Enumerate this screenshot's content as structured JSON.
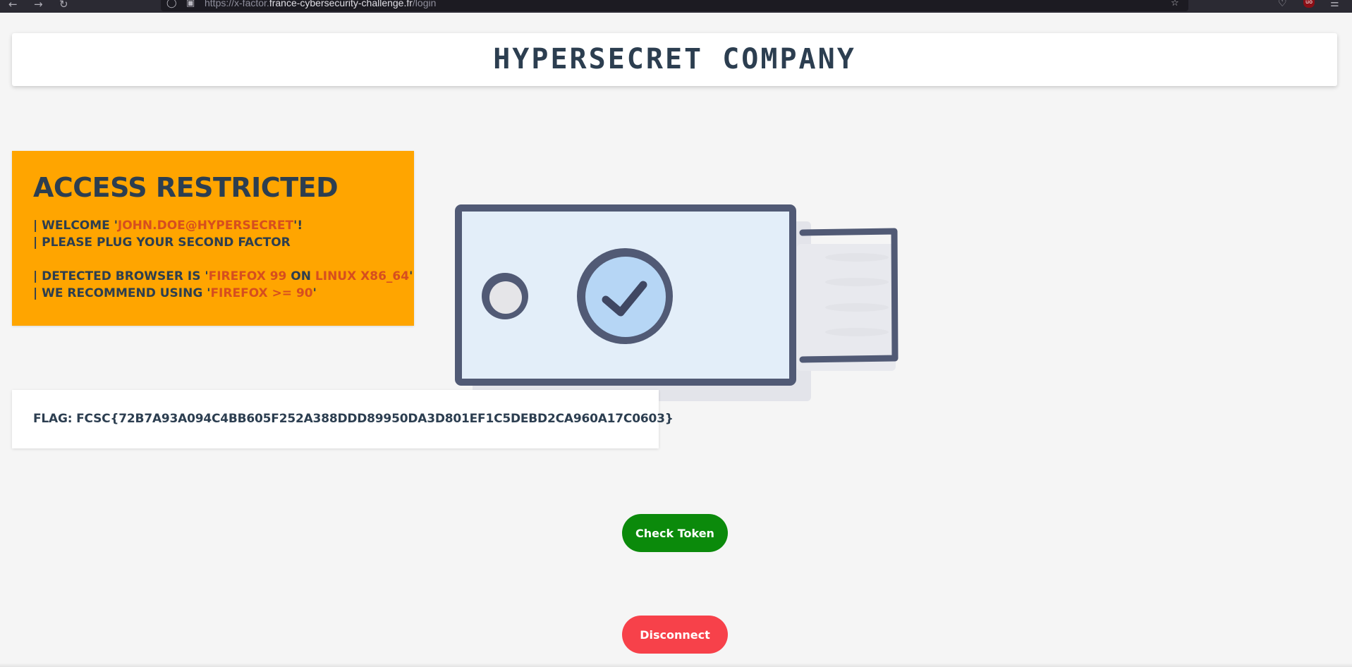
{
  "browser": {
    "url_prefix": "https://x-factor.",
    "url_host": "france-cybersecurity-challenge.fr",
    "url_path": "/login",
    "back_icon": "arrow-left-icon",
    "forward_icon": "arrow-right-icon",
    "reload_icon": "reload-icon",
    "bookmark_icon": "star-icon",
    "pocket_icon": "pocket-icon",
    "extension_icon": "ublock-icon",
    "menu_icon": "hamburger-menu-icon"
  },
  "header": {
    "title": "HYPERSECRET COMPANY"
  },
  "access": {
    "title": "ACCESS RESTRICTED",
    "welcome_prefix": "| WELCOME '",
    "welcome_user": "JOHN.DOE@HYPERSECRET",
    "welcome_suffix": "'!",
    "plug": "| PLEASE PLUG YOUR SECOND FACTOR",
    "detected_prefix": "| DETECTED BROWSER IS '",
    "detected_browser": "FIREFOX 99",
    "detected_on": " ON ",
    "detected_os": "LINUX X86_64",
    "detected_suffix": "'",
    "recommend_prefix": "| WE RECOMMEND USING '",
    "recommend_browser": "FIREFOX >= 90",
    "recommend_suffix": "'"
  },
  "flag": {
    "text": "FLAG: FCSC{72B7A93A094C4BB605F252A388DDD89950DA3D801EF1C5DEBD2CA960A17C0603}"
  },
  "buttons": {
    "check_token": "Check Token",
    "disconnect": "Disconnect"
  },
  "colors": {
    "panel_bg": "#ffa500",
    "highlight": "#d64e1f",
    "text_dark": "#2c3e50",
    "check_btn": "#0b8a0b",
    "disconnect_btn": "#f7414a"
  }
}
